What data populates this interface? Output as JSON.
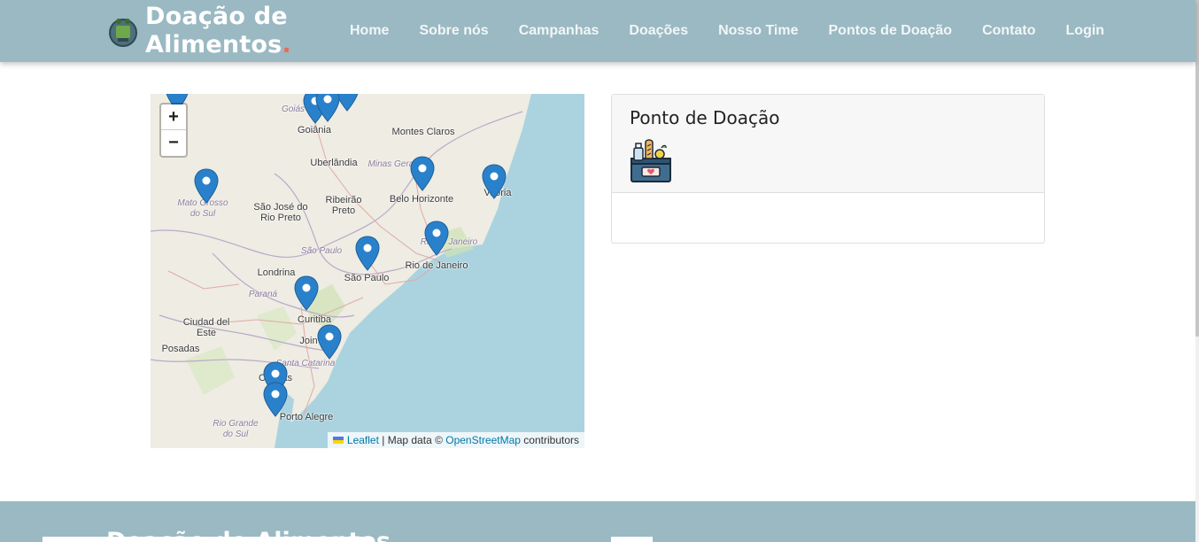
{
  "brand": {
    "line1": "Doação de",
    "line2": "Alimentos",
    "dot": "."
  },
  "nav": {
    "items": [
      "Home",
      "Sobre nós",
      "Campanhas",
      "Doações",
      "Nosso Time",
      "Pontos de Doação",
      "Contato",
      "Login"
    ]
  },
  "map": {
    "zoom_in": "+",
    "zoom_out": "−",
    "cities": [
      "Goiânia",
      "Montes Claros",
      "Uberlândia",
      "Belo Horizonte",
      "Vitória",
      "São José do Rio Preto",
      "Ribeirão Preto",
      "Rio de Janeiro",
      "Londrina",
      "São Paulo",
      "Curitiba",
      "Ciudad del Este",
      "Posadas",
      "Joinville",
      "Canoas",
      "Porto Alegre"
    ],
    "regions": [
      "Goiás",
      "Minas Gerais",
      "Mato Grosso do Sul",
      "São Paulo",
      "Rio de Janeiro",
      "Paraná",
      "Santa Catarina",
      "Rio Grande do Sul"
    ],
    "attribution": {
      "leaflet": "Leaflet",
      "separator": " | Map data © ",
      "osm": "OpenStreetMap",
      "contributors": " contributors"
    },
    "marker_count": 13
  },
  "card": {
    "title": "Ponto de Doação",
    "icon": "food-donation-box-icon"
  },
  "footer": {
    "title": "Doação de Alimentos"
  },
  "colors": {
    "navbar": "#9ab9c2",
    "accent": "#e96b56",
    "marker": "#2a81cb",
    "water": "#aad3df"
  }
}
